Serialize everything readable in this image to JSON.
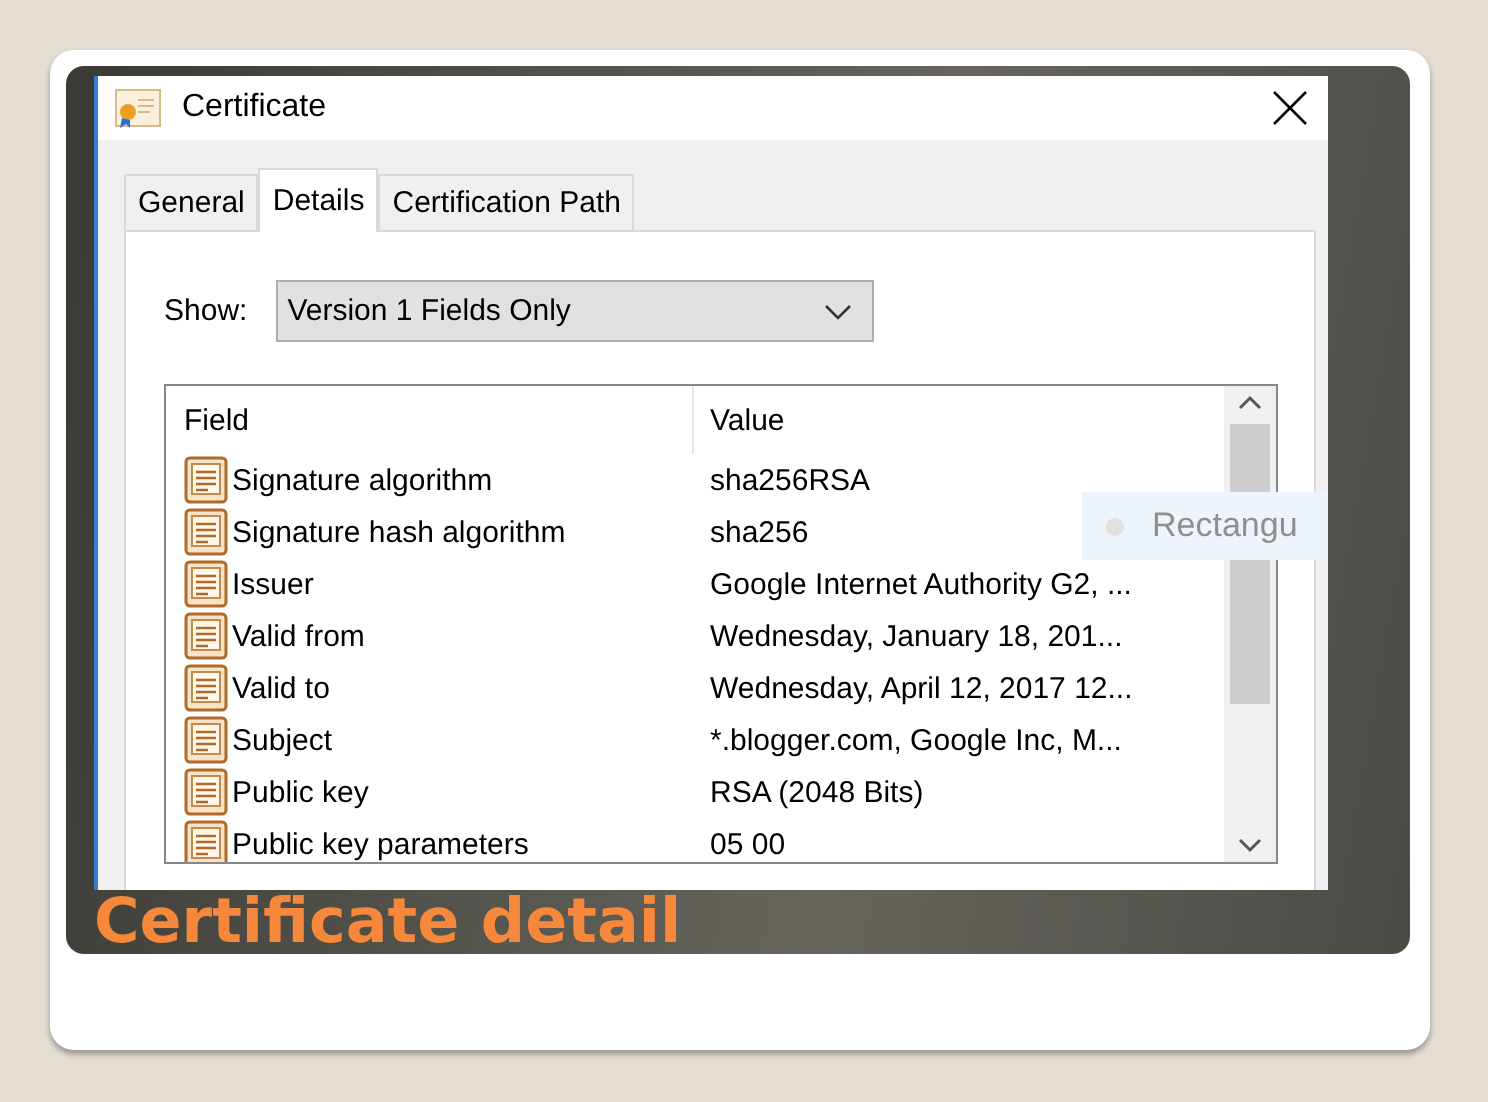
{
  "dialog": {
    "title": "Certificate",
    "tabs": [
      {
        "label": "General",
        "selected": false
      },
      {
        "label": "Details",
        "selected": true
      },
      {
        "label": "Certification Path",
        "selected": false
      }
    ],
    "show": {
      "label": "Show:",
      "value": "Version 1 Fields Only"
    },
    "table": {
      "columns": [
        "Field",
        "Value"
      ],
      "rows": [
        {
          "field": "Signature algorithm",
          "value": "sha256RSA"
        },
        {
          "field": "Signature hash algorithm",
          "value": "sha256"
        },
        {
          "field": "Issuer",
          "value": "Google Internet Authority G2, ..."
        },
        {
          "field": "Valid from",
          "value": "Wednesday, January 18, 201..."
        },
        {
          "field": "Valid to",
          "value": "Wednesday, April 12, 2017 12..."
        },
        {
          "field": "Subject",
          "value": "*.blogger.com, Google Inc, M..."
        },
        {
          "field": "Public key",
          "value": "RSA (2048 Bits)"
        },
        {
          "field": "Public key parameters",
          "value": "05 00"
        }
      ]
    }
  },
  "overlay": {
    "label": "Rectangu"
  },
  "slide": {
    "caption": "Certificate detail"
  }
}
